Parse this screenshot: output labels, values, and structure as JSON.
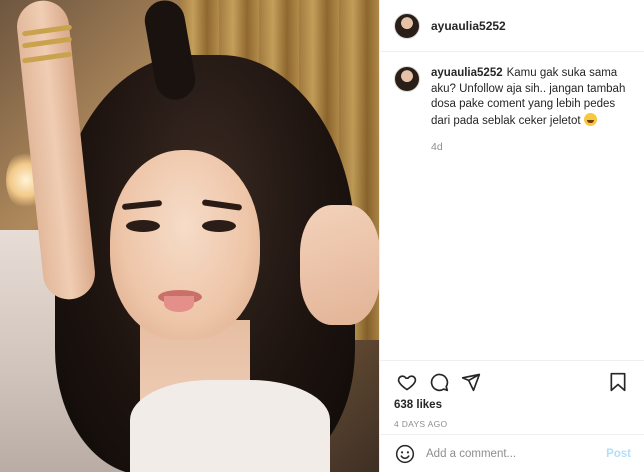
{
  "post": {
    "author": {
      "username": "ayuaulia5252"
    },
    "caption": {
      "username": "ayuaulia5252",
      "text": "Kamu gak suka sama aku? Unfollow aja sih.. jangan tambah dosa pake coment yang lebih pedes dari pada seblak ceker jeletot",
      "emoji": "rolling-on-floor-laughing-emoji",
      "age": "4d"
    },
    "actions": {
      "like_icon": "heart-icon",
      "comment_icon": "comment-bubble-icon",
      "share_icon": "paper-plane-icon",
      "save_icon": "bookmark-icon"
    },
    "likes": "638 likes",
    "date": "4 DAYS AGO",
    "add_comment": {
      "placeholder": "Add a comment...",
      "post_label": "Post",
      "emoji_icon": "smiley-icon"
    }
  },
  "colors": {
    "border": "#efefef",
    "secondary_text": "#8e8e8e",
    "post_button_disabled": "#b2dffc",
    "text": "#262626"
  }
}
